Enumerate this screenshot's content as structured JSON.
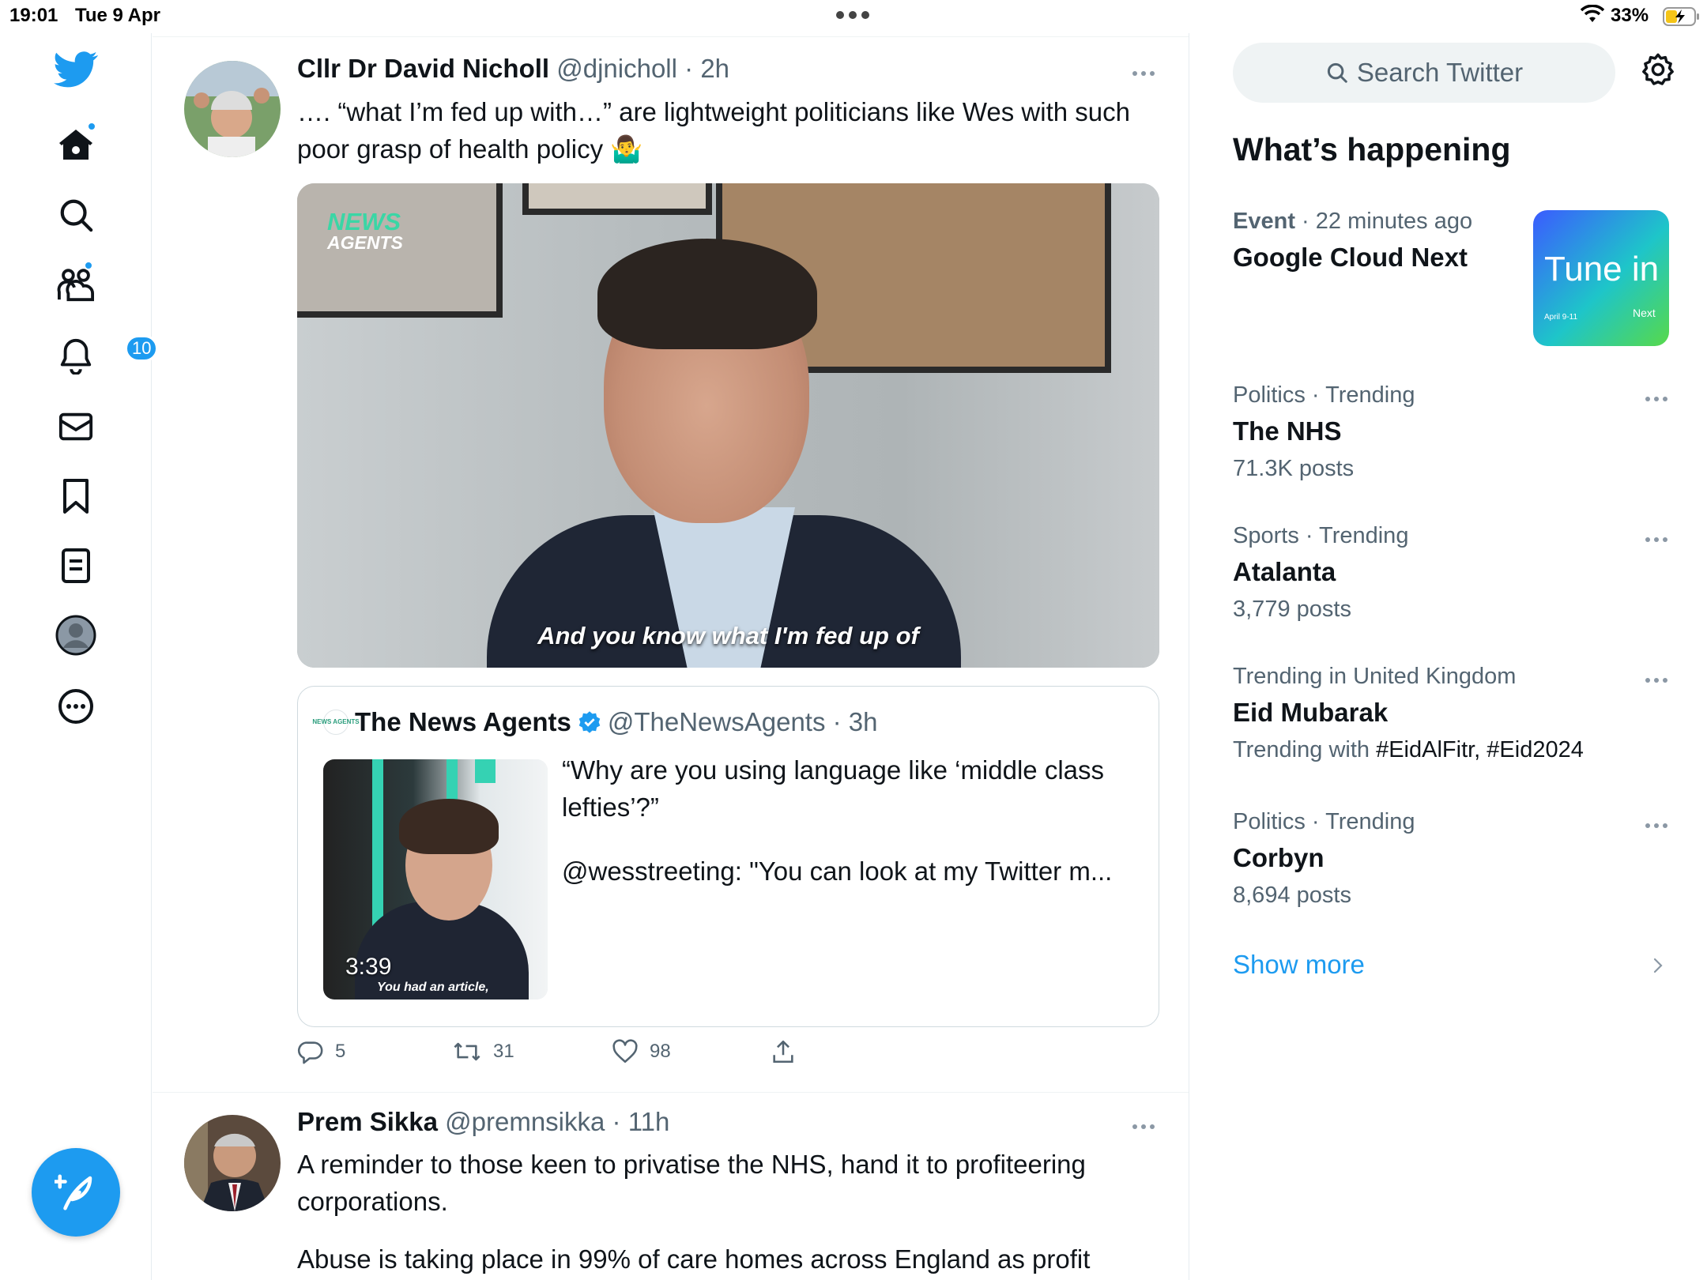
{
  "status_bar": {
    "time": "19:01",
    "date": "Tue 9 Apr",
    "battery": "33%"
  },
  "nav": {
    "items": [
      {
        "name": "twitter-logo",
        "label": ""
      },
      {
        "name": "home",
        "label": ""
      },
      {
        "name": "explore",
        "label": ""
      },
      {
        "name": "communities",
        "label": ""
      },
      {
        "name": "notifications",
        "label": ""
      },
      {
        "name": "messages",
        "label": ""
      },
      {
        "name": "bookmarks",
        "label": ""
      },
      {
        "name": "lists",
        "label": ""
      },
      {
        "name": "profile",
        "label": ""
      },
      {
        "name": "more",
        "label": ""
      }
    ],
    "notifications_badge": "10",
    "accent": "#1d9bf0"
  },
  "tweets": [
    {
      "name": "Cllr Dr David Nicholl",
      "handle": "@djnicholl",
      "sep": "·",
      "time": "2h",
      "text": "…. “what I’m fed up with…” are lightweight politicians like Wes with such  poor grasp of health policy 🤷‍♂️",
      "video": {
        "logo_line1": "NEWS",
        "logo_line2": "AGENTS",
        "caption": "And you know what I'm fed up of"
      },
      "quote": {
        "name": "The News Agents",
        "handle": "@TheNewsAgents",
        "sep": "·",
        "time": "3h",
        "logo_text": "NEWS AGENTS",
        "duration": "3:39",
        "thumb_caption": "You had an article,",
        "text": "“Why are you using language like ‘middle class lefties’?”",
        "text2": "@wesstreeting: \"You can look at my Twitter m..."
      },
      "actions": {
        "replies": "5",
        "retweets": "31",
        "likes": "98"
      }
    },
    {
      "name": "Prem Sikka",
      "handle": "@premnsikka",
      "sep": "·",
      "time": "11h",
      "text": "A reminder to those keen to privatise the NHS, hand it to profiteering corporations.",
      "text2": "Abuse is taking place in 99% of care homes across England as profit"
    }
  ],
  "right": {
    "search_placeholder": "Search Twitter",
    "whats_happening": "What’s happening",
    "event": {
      "category": "Event",
      "sep": "·",
      "meta": "22 minutes ago",
      "title": "Google Cloud Next",
      "image_text": "Tune in",
      "image_date": "April 9-11",
      "image_brand": "Next"
    },
    "trends": [
      {
        "meta": "Politics · Trending",
        "name": "The NHS",
        "count": "71.3K posts"
      },
      {
        "meta": "Sports · Trending",
        "name": "Atalanta",
        "count": "3,779 posts"
      },
      {
        "meta": "Trending in United Kingdom",
        "name": "Eid Mubarak",
        "count_prefix": "Trending with ",
        "count_tags": "#EidAlFitr, #Eid2024"
      },
      {
        "meta": "Politics · Trending",
        "name": "Corbyn",
        "count": "8,694 posts"
      }
    ],
    "show_more": "Show more"
  }
}
